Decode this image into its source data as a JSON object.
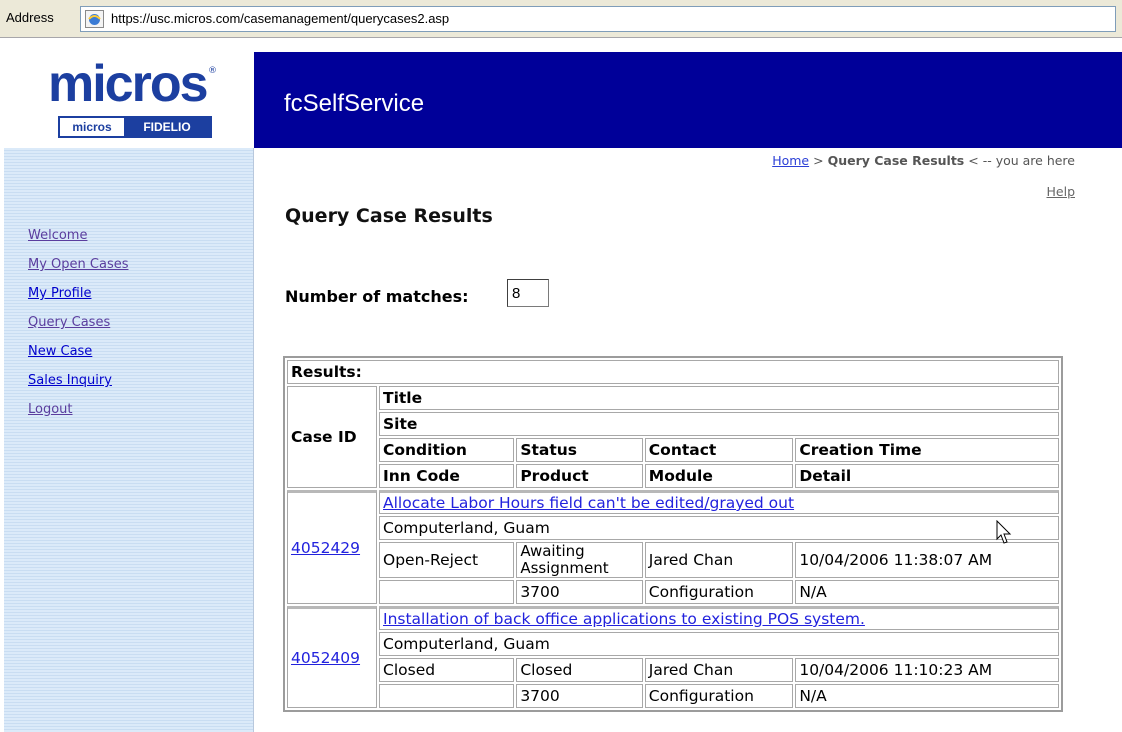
{
  "browser": {
    "address_label": "Address",
    "url": "https://usc.micros.com/casemanagement/querycases2.asp"
  },
  "header": {
    "logo_text": "micros",
    "logo_sub_left": "micros",
    "logo_sub_right": "FIDELIO",
    "app_title": "fcSelfService",
    "brand_color": "#000099"
  },
  "sidebar": {
    "items": [
      {
        "label": "Welcome"
      },
      {
        "label": "My Open Cases"
      },
      {
        "label": "My Profile"
      },
      {
        "label": "Query Cases"
      },
      {
        "label": "New Case"
      },
      {
        "label": "Sales Inquiry"
      },
      {
        "label": "Logout"
      }
    ]
  },
  "breadcrumb": {
    "home": "Home",
    "separator": ">",
    "current": "Query Case Results",
    "suffix": "< -- you are here"
  },
  "help_link": "Help",
  "page_title": "Query Case Results",
  "matches": {
    "label": "Number of matches:",
    "value": "8"
  },
  "results": {
    "caption": "Results:",
    "headers": {
      "case_id": "Case ID",
      "title": "Title",
      "site": "Site",
      "condition": "Condition",
      "status": "Status",
      "contact": "Contact",
      "creation_time": "Creation Time",
      "inn_code": "Inn Code",
      "product": "Product",
      "module": "Module",
      "detail": "Detail"
    },
    "rows": [
      {
        "case_id": "4052429",
        "title": "Allocate Labor Hours field can't be edited/grayed out",
        "site": "Computerland, Guam",
        "condition": "Open-Reject",
        "status_line1": "Awaiting",
        "status_line2": "Assignment",
        "contact": "Jared Chan",
        "creation_time": "10/04/2006 11:38:07 AM",
        "inn_code": "",
        "product": "3700",
        "module": "Configuration",
        "detail": "N/A"
      },
      {
        "case_id": "4052409",
        "title": "Installation of back office applications to existing POS system.",
        "site": "Computerland, Guam",
        "condition": "Closed",
        "status": "Closed",
        "contact": "Jared Chan",
        "creation_time": "10/04/2006 11:10:23 AM",
        "inn_code": "",
        "product": "3700",
        "module": "Configuration",
        "detail": "N/A"
      }
    ]
  }
}
